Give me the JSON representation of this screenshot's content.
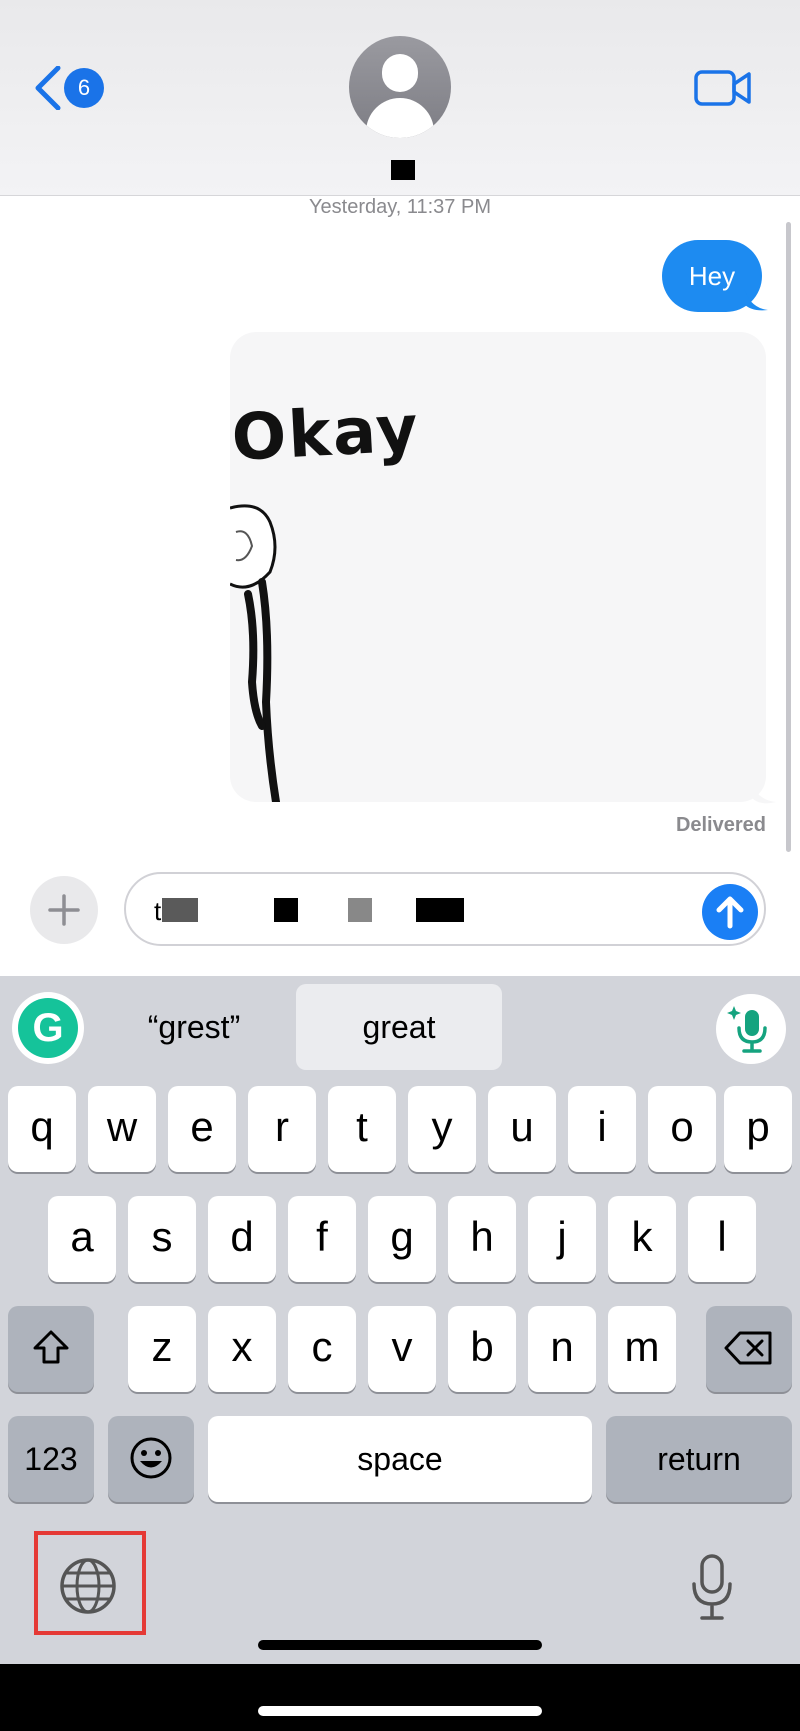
{
  "header": {
    "back_badge": "6"
  },
  "chat": {
    "timestamp": "Yesterday, 11:37 PM",
    "sent_message": "Hey",
    "image_text": "Okay",
    "status": "Delivered"
  },
  "input": {
    "typed_prefix": "t"
  },
  "keyboard": {
    "suggestions": [
      "“grest”",
      "great"
    ],
    "row1": [
      "q",
      "w",
      "e",
      "r",
      "t",
      "y",
      "u",
      "i",
      "o",
      "p"
    ],
    "row2": [
      "a",
      "s",
      "d",
      "f",
      "g",
      "h",
      "j",
      "k",
      "l"
    ],
    "row3": [
      "z",
      "x",
      "c",
      "v",
      "b",
      "n",
      "m"
    ],
    "numbers_label": "123",
    "space_label": "space",
    "return_label": "return"
  },
  "colors": {
    "accent": "#1d8bf1",
    "highlight": "#e53935",
    "grammarly": "#15c39a"
  },
  "icons": [
    "back-chevron-icon",
    "avatar-icon",
    "video-camera-icon",
    "plus-icon",
    "send-arrow-icon",
    "grammarly-icon",
    "ai-dictation-icon",
    "shift-icon",
    "delete-icon",
    "emoji-icon",
    "globe-icon",
    "microphone-icon"
  ]
}
